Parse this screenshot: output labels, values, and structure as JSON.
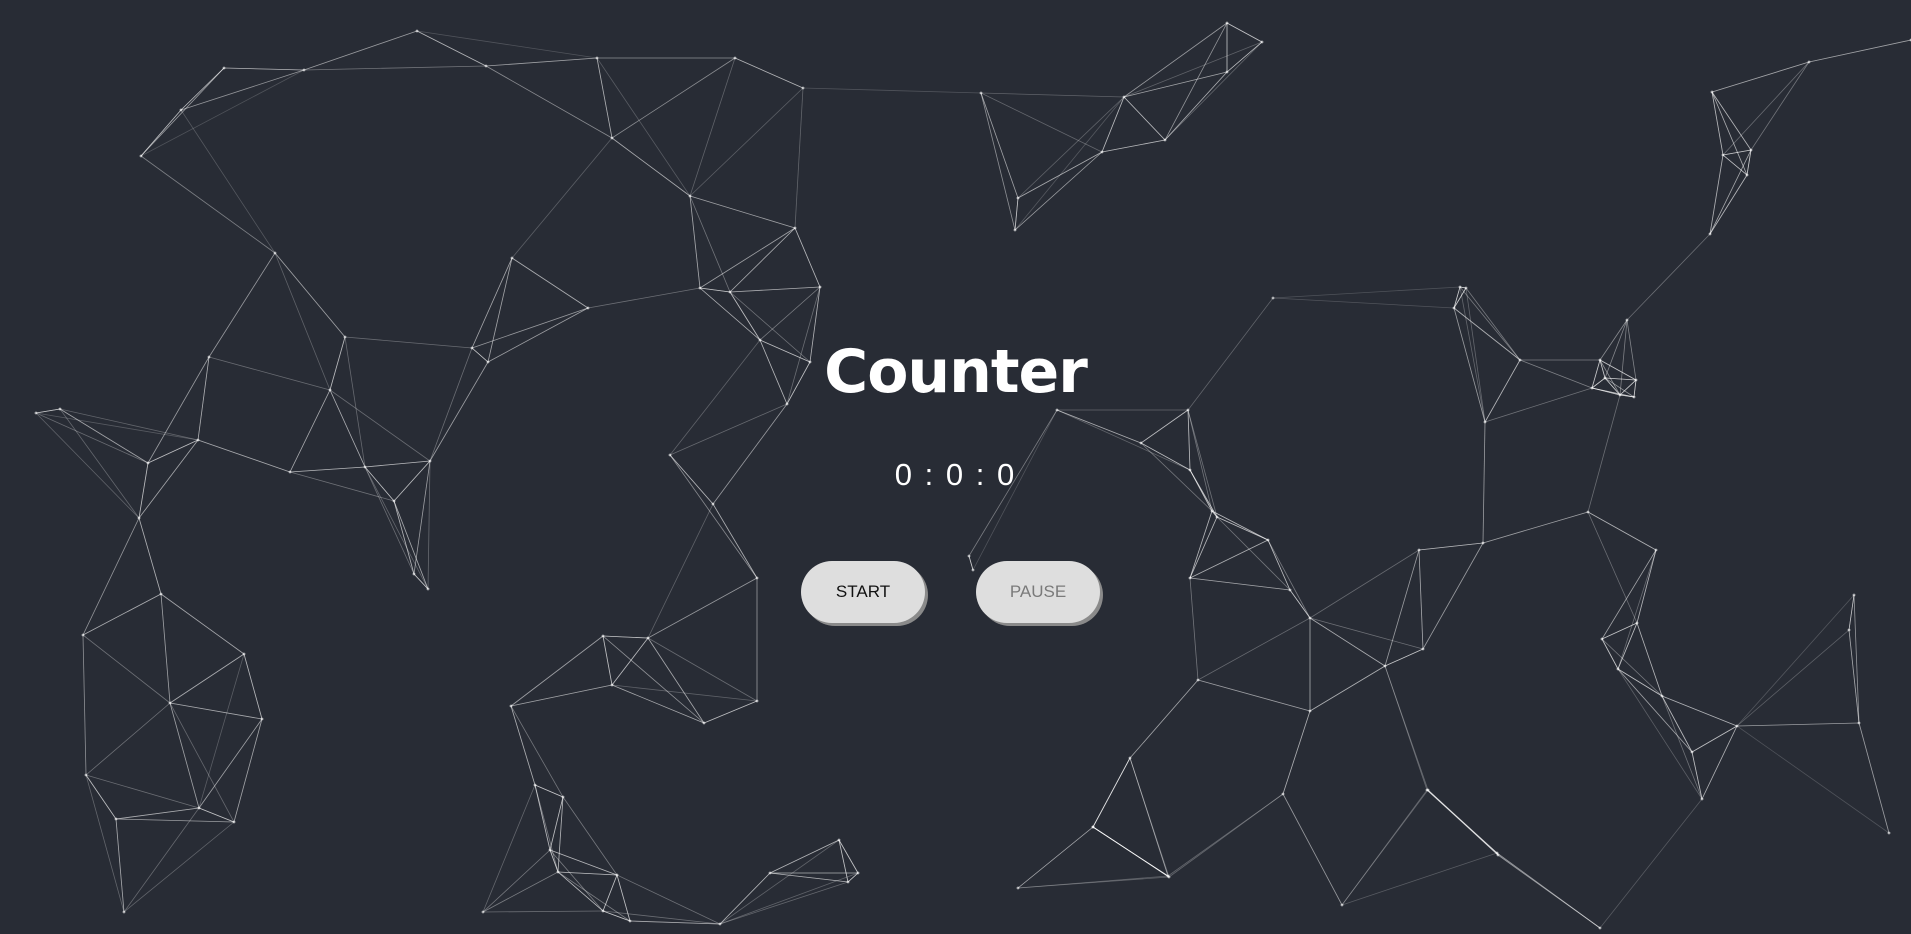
{
  "app": {
    "title": "Counter",
    "timer_display": "0 : 0 : 0"
  },
  "controls": {
    "start_label": "START",
    "pause_label": "PAUSE"
  },
  "colors": {
    "background": "#282c35",
    "button_bg": "#dedede",
    "title": "#ffffff",
    "network_lines": "#ffffff"
  }
}
